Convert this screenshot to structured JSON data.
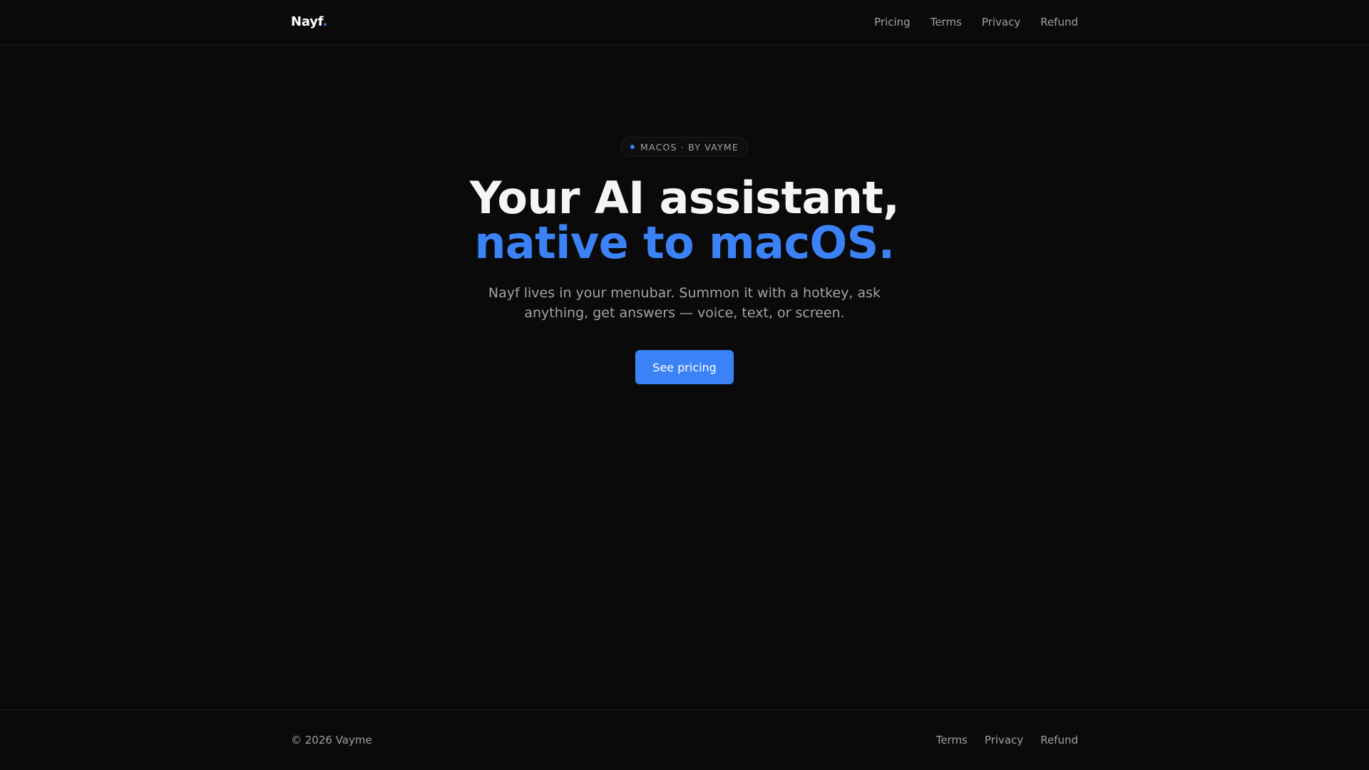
{
  "header": {
    "brand": "Nayf",
    "brand_dot": ".",
    "nav": [
      "Pricing",
      "Terms",
      "Privacy",
      "Refund"
    ]
  },
  "hero": {
    "badge": "MACOS · BY VAYME",
    "headline_line1": "Your AI assistant,",
    "headline_line2": "native to macOS.",
    "subtitle": "Nayf lives in your menubar. Summon it with a hotkey, ask anything, get answers — voice, text, or screen.",
    "cta_label": "See pricing"
  },
  "footer": {
    "copyright": "© 2026 Vayme",
    "nav": [
      "Terms",
      "Privacy",
      "Refund"
    ]
  },
  "colors": {
    "background": "#0a0a0a",
    "accent": "#3b82f6",
    "text_muted": "#a1a1a1"
  }
}
